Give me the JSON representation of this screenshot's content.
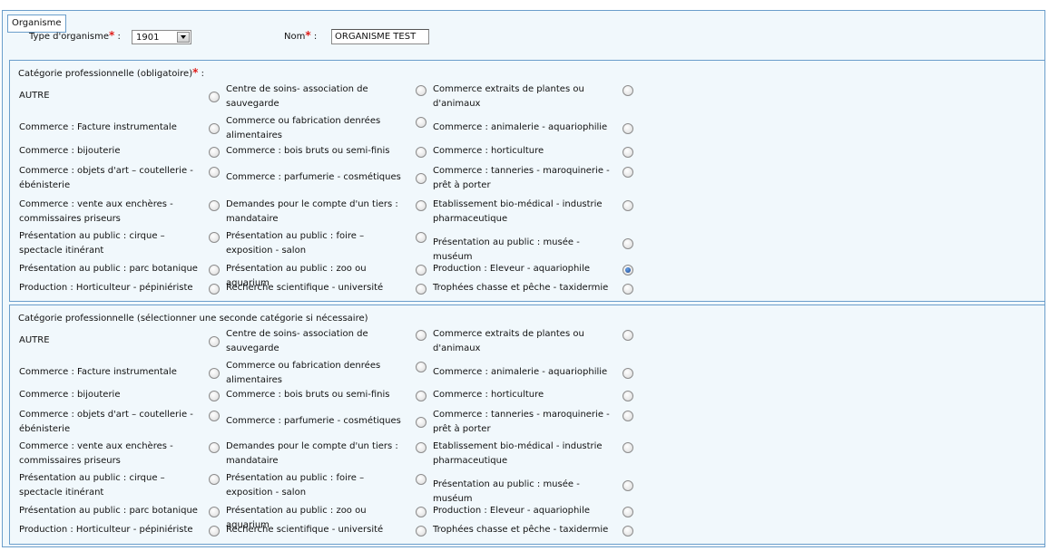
{
  "legend": "Organisme",
  "type_organisme": {
    "label": "Type d'organisme",
    "required": "*",
    "colon": ":",
    "value": "1901"
  },
  "nom": {
    "label": "Nom",
    "required": "*",
    "colon": ":",
    "value": "ORGANISME TEST"
  },
  "categories": [
    {
      "title": "Catégorie professionnelle (obligatoire)",
      "required": "*",
      "title_suffix": " :",
      "selected": 20,
      "options": [
        "AUTRE",
        "Centre de soins- association de sauvegarde",
        "Commerce extraits de plantes ou d'animaux",
        "Commerce : Facture instrumentale",
        "Commerce ou fabrication denrées alimentaires",
        "Commerce  : animalerie - aquariophilie",
        "Commerce  : bijouterie",
        "Commerce  : bois bruts ou semi-finis",
        "Commerce  : horticulture",
        "Commerce  : objets d'art – coutellerie - ébénisterie",
        "Commerce  : parfumerie - cosmétiques",
        "Commerce  : tanneries - maroquinerie - prêt à porter",
        "Commerce  : vente aux enchères - commissaires priseurs",
        "Demandes pour le compte d'un tiers : mandataire",
        "Etablissement bio-médical - industrie pharmaceutique",
        "Présentation au public  : cirque – spectacle itinérant",
        "Présentation au public  : foire – exposition - salon",
        "Présentation au public  : musée - muséum",
        "Présentation au public  : parc botanique",
        "Présentation au public  : zoo ou aquarium",
        "Production : Eleveur - aquariophile",
        "Production : Horticulteur - pépiniériste",
        "Recherche scientifique - université",
        "Trophées chasse et pêche - taxidermie"
      ]
    },
    {
      "title": "Catégorie professionnelle (sélectionner une seconde catégorie si nécessaire)",
      "required": "",
      "title_suffix": "",
      "selected": -1,
      "options": [
        "AUTRE",
        "Centre de soins- association de sauvegarde",
        "Commerce extraits de plantes ou d'animaux",
        "Commerce : Facture instrumentale",
        "Commerce ou fabrication denrées alimentaires",
        "Commerce  : animalerie - aquariophilie",
        "Commerce  : bijouterie",
        "Commerce  : bois bruts ou semi-finis",
        "Commerce  : horticulture",
        "Commerce  : objets d'art – coutellerie - ébénisterie",
        "Commerce  : parfumerie - cosmétiques",
        "Commerce  : tanneries - maroquinerie - prêt à porter",
        "Commerce  : vente aux enchères - commissaires priseurs",
        "Demandes pour le compte d'un tiers : mandataire",
        "Etablissement bio-médical - industrie pharmaceutique",
        "Présentation au public  : cirque – spectacle itinérant",
        "Présentation au public  : foire – exposition - salon",
        "Présentation au public  : musée - muséum",
        "Présentation au public  : parc botanique",
        "Présentation au public  : zoo ou aquarium",
        "Production : Eleveur - aquariophile",
        "Production : Horticulteur - pépiniériste",
        "Recherche scientifique - université",
        "Trophées chasse et pêche - taxidermie"
      ]
    }
  ]
}
